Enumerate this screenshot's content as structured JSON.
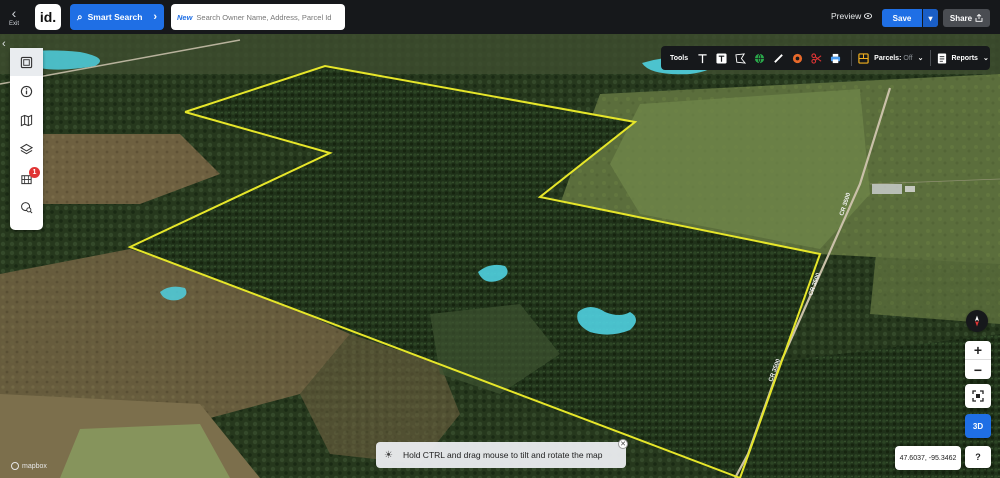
{
  "topbar": {
    "exit_label": "Exit",
    "logo_text": "id.",
    "smart_search_label": "Smart Search",
    "search_new_tag": "New",
    "search_placeholder": "Search Owner Name, Address, Parcel Id",
    "preview_label": "Preview",
    "save_label": "Save",
    "share_label": "Share"
  },
  "sidebar": {
    "items": [
      {
        "icon": "panel-icon"
      },
      {
        "icon": "info-icon"
      },
      {
        "icon": "map-icon"
      },
      {
        "icon": "layers-icon"
      },
      {
        "icon": "grid-building-icon",
        "badge": "1"
      },
      {
        "icon": "location-search-icon"
      }
    ]
  },
  "toolbar": {
    "tools_label": "Tools",
    "parcels_label": "Parcels:",
    "parcels_state": "Off",
    "reports_label": "Reports",
    "icons": [
      "text-icon",
      "text-box-icon",
      "polygon-icon",
      "globe-icon",
      "ruler-icon",
      "circle-target-icon",
      "scissors-icon",
      "print-icon"
    ]
  },
  "map": {
    "road_labels": [
      "CR 3500",
      "CR 3500",
      "CR 3500"
    ],
    "hint_text": "Hold CTRL and drag mouse to tilt and rotate the map",
    "coordinates": "47.6037, -95.3462",
    "attribution": "mapbox",
    "zoom_in": "+",
    "zoom_out": "−",
    "three_d_label": "3D",
    "help_label": "?",
    "colors": {
      "parcel_outline": "#e6e62a",
      "water": "#4fd0e0",
      "accent": "#1f6fe5"
    }
  }
}
